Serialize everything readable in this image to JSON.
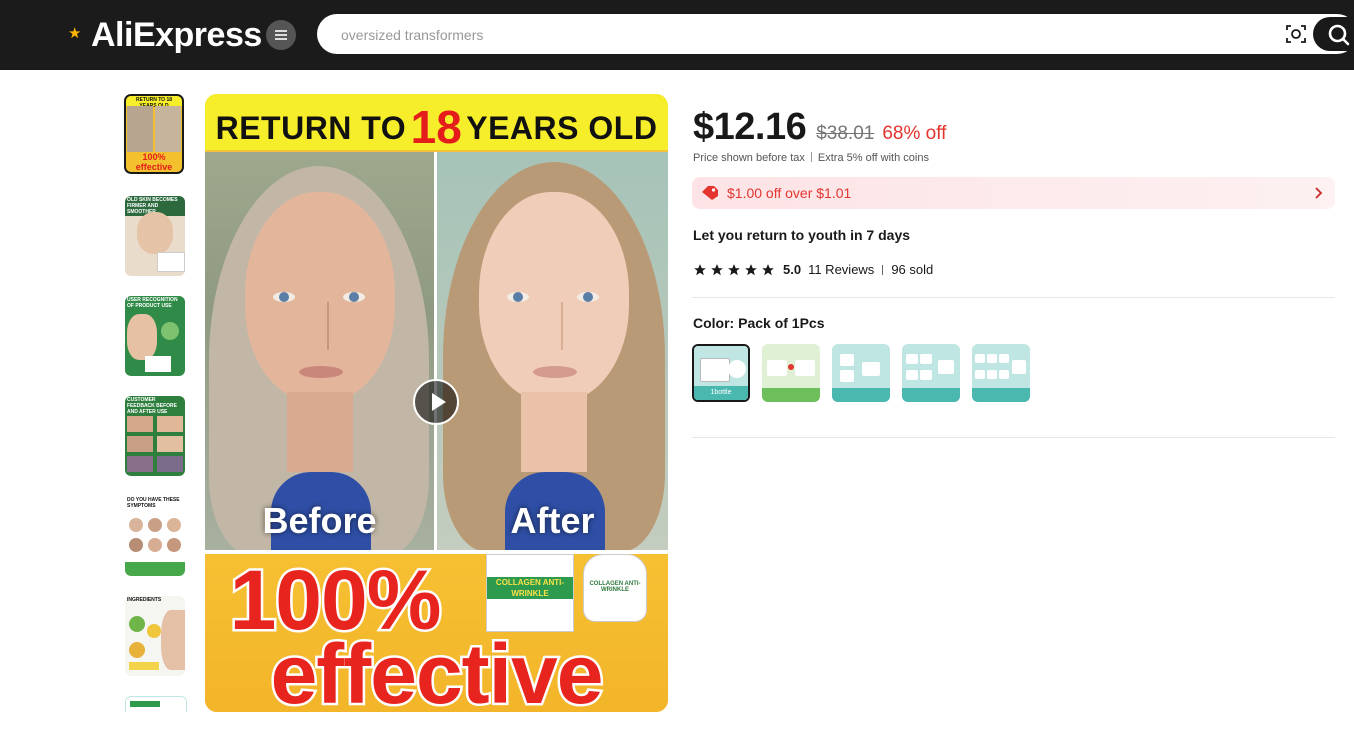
{
  "header": {
    "logo_text": "AliExpress",
    "search_placeholder": "oversized transformers"
  },
  "gallery": {
    "main": {
      "top_text_a": "RETURN TO",
      "top_text_b": "18",
      "top_text_c": "YEARS OLD",
      "before_label": "Before",
      "after_label": "After",
      "big_text_1": "100%",
      "big_text_2": "effective",
      "jar_text": "COLLAGEN ANTI-WRINKLE"
    },
    "thumbnails": [
      {
        "caption": "RETURN TO 18 YEARS OLD",
        "bottom": "100% effective"
      },
      {
        "caption": "OLD SKIN BECOMES FIRMER AND SMOOTHER"
      },
      {
        "caption": "USER RECOGNITION OF PRODUCT USE"
      },
      {
        "caption": "CUSTOMER FEEDBACK BEFORE AND AFTER USE"
      },
      {
        "caption": "DO YOU HAVE THESE SYMPTOMS"
      },
      {
        "caption": "INGREDIENTS"
      }
    ]
  },
  "product": {
    "price": "$12.16",
    "original_price": "$38.01",
    "discount": "68% off",
    "tax_note": "Price shown before tax",
    "coins_note": "Extra 5% off with coins",
    "coupon": "$1.00 off over $1.01",
    "headline": "Let you return to youth in 7 days",
    "rating": "5.0",
    "stars": 5,
    "reviews": "11 Reviews",
    "sold": "96 sold",
    "color_label": "Color: Pack of 1Pcs",
    "swatch_labels": [
      "1bottle",
      "",
      "",
      "",
      ""
    ]
  },
  "colors": {
    "header_bg": "#1b1b1b",
    "discount_red": "#e3342f",
    "coupon_bg": "#fde3e5"
  }
}
